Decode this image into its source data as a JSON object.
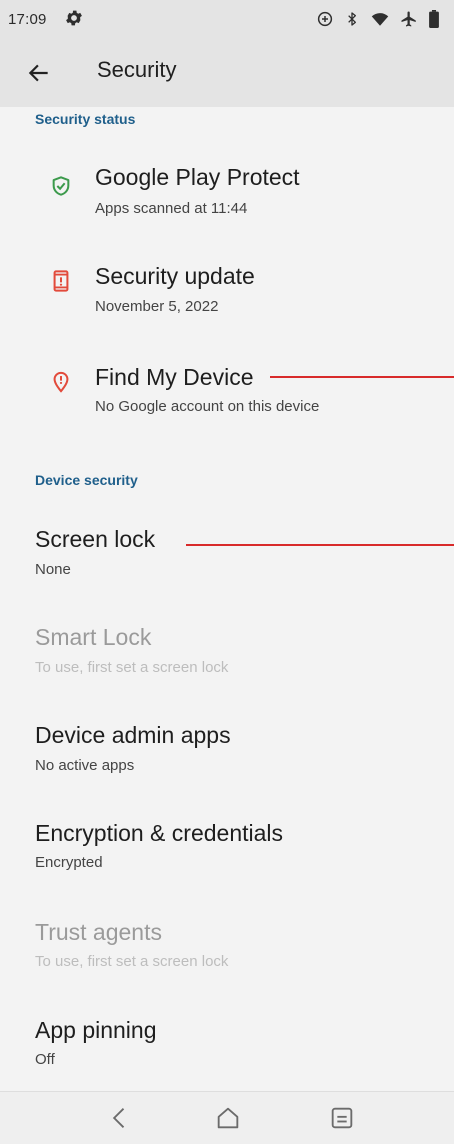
{
  "status_bar": {
    "time": "17:09",
    "icons": [
      "settings-gear-icon",
      "data-saver-icon",
      "bluetooth-icon",
      "wifi-icon",
      "airplane-mode-icon",
      "battery-icon"
    ]
  },
  "app_bar": {
    "title": "Security",
    "back_icon": "arrow-back-icon"
  },
  "sections": {
    "security_status": {
      "header": "Security status",
      "items": [
        {
          "title": "Google Play Protect",
          "subtitle": "Apps scanned at 11:44",
          "icon": "shield-check-icon",
          "icon_color": "#3c9a4c"
        },
        {
          "title": "Security update",
          "subtitle": "November 5, 2022",
          "icon": "phone-alert-icon",
          "icon_color": "#e24a3b"
        },
        {
          "title": "Find My Device",
          "subtitle": "No Google account on this device",
          "icon": "location-alert-icon",
          "icon_color": "#e24a3b"
        }
      ]
    },
    "device_security": {
      "header": "Device security",
      "items": [
        {
          "title": "Screen lock",
          "subtitle": "None",
          "enabled": true
        },
        {
          "title": "Smart Lock",
          "subtitle": "To use, first set a screen lock",
          "enabled": false
        },
        {
          "title": "Device admin apps",
          "subtitle": "No active apps",
          "enabled": true
        },
        {
          "title": "Encryption & credentials",
          "subtitle": "Encrypted",
          "enabled": true
        },
        {
          "title": "Trust agents",
          "subtitle": "To use, first set a screen lock",
          "enabled": false
        },
        {
          "title": "App pinning",
          "subtitle": "Off",
          "enabled": true
        }
      ]
    }
  },
  "nav_bar": {
    "buttons": [
      "back-chevron-icon",
      "home-icon",
      "recents-icon"
    ]
  },
  "colors": {
    "accent": "#1f5f8b",
    "alert_red": "#e24a3b",
    "protect_green": "#3c9a4c",
    "marker_red": "#d82a2a"
  }
}
